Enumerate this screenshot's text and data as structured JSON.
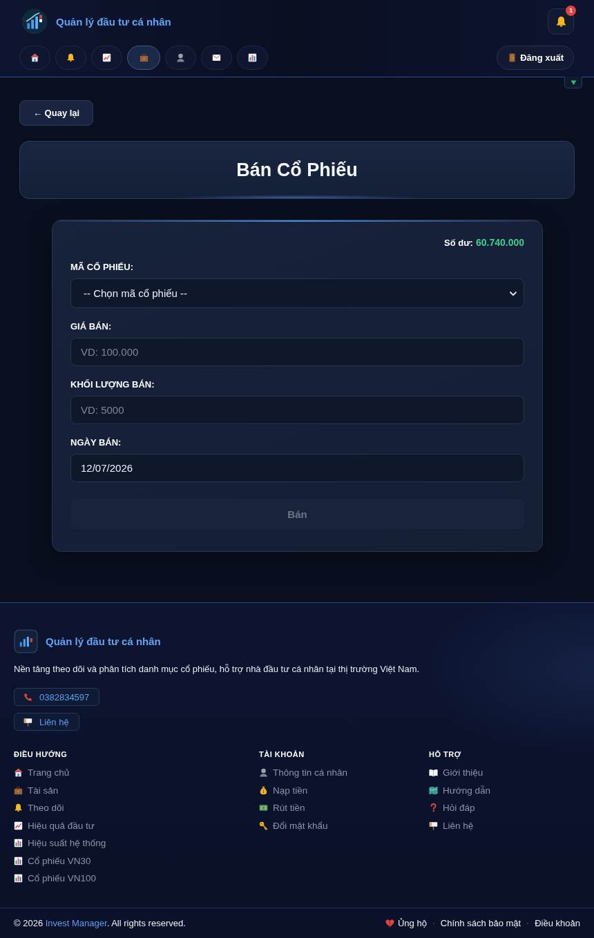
{
  "header": {
    "brand": "Quản lý đầu tư cá nhân",
    "notification_count": "1",
    "nav": [
      {
        "selected": false
      },
      {
        "selected": false
      },
      {
        "selected": false
      },
      {
        "selected": true
      },
      {
        "selected": false
      },
      {
        "selected": false
      },
      {
        "selected": false
      }
    ],
    "logout": "Đăng xuất",
    "toggle": {
      "expanded": false
    }
  },
  "back_button": "← Quay lại",
  "page_title": "Bán Cổ Phiếu",
  "form": {
    "balance_label": "Số dư:",
    "balance": "60.740.000",
    "fields": [
      {
        "kind": "select",
        "label": "MÃ CỔ PHIẾU:",
        "value": "-- Chọn mã cổ phiếu --"
      },
      {
        "kind": "input",
        "label": "GIÁ BÁN:",
        "placeholder": "VD: 100.000"
      },
      {
        "kind": "input",
        "label": "KHỐI LƯỢNG BÁN:",
        "placeholder": "VD: 5000"
      },
      {
        "kind": "input",
        "label": "NGÀY BÁN:",
        "value": "12/07/2026"
      }
    ],
    "submit": {
      "label": "Bán",
      "disabled": true
    }
  },
  "footer": {
    "brand": "Quản lý đầu tư cá nhân",
    "description": "Nền tảng theo dõi và phân tích danh mục cổ phiếu, hỗ trợ nhà đầu tư cá nhân tại thị trường Việt Nam.",
    "contacts": [
      {
        "kind": "phone",
        "label": "0382834597"
      },
      {
        "kind": "contact",
        "label": "Liên hệ"
      }
    ],
    "columns": [
      {
        "title": "ĐIỀU HƯỚNG",
        "links": [
          "Trang chủ",
          "Tài sản",
          "Theo dõi",
          "Hiệu quả đầu tư",
          "Hiệu suất hệ thống",
          "Cổ phiếu VN30",
          "Cổ phiếu VN100"
        ]
      },
      {
        "title": "TÀI KHOẢN",
        "links": [
          "Thông tin cá nhân",
          "Nạp tiền",
          "Rút tiền",
          "Đổi mật khẩu"
        ]
      },
      {
        "title": "HỖ TRỢ",
        "links": [
          "Giới thiệu",
          "Hướng dẫn",
          "Hỏi đáp",
          "Liên hệ"
        ]
      }
    ],
    "copyright": {
      "before": "© 2026 ",
      "link": "Invest Manager",
      "after": ". All rights reserved."
    },
    "links": [
      "Ủng hộ",
      "Chính sách bảo mật",
      "Điều khoản"
    ]
  }
}
